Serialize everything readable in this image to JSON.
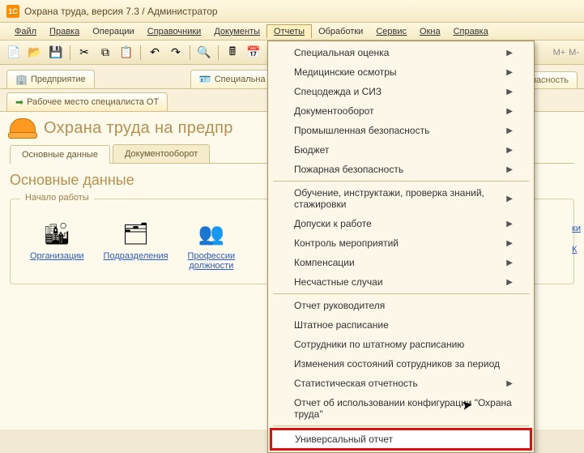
{
  "window": {
    "title": "Охрана труда, версия 7.3 / Администратор"
  },
  "menubar": {
    "file": "Файл",
    "edit": "Правка",
    "operations": "Операции",
    "references": "Справочники",
    "documents": "Документы",
    "reports": "Отчеты",
    "processing": "Обработки",
    "service": "Сервис",
    "windows": "Окна",
    "help": "Справка"
  },
  "toolbar": {
    "m_plus": "M+",
    "m_minus": "M-"
  },
  "tabs": {
    "t1": "Предприятие",
    "t2": "Специальна",
    "t3": "Рабочее место специалиста ОТ",
    "safety": "пасность"
  },
  "page": {
    "title": "Охрана труда на предпр",
    "inner_tabs": {
      "main": "Основные данные",
      "doc": "Документооборот"
    },
    "section": "Основные данные",
    "group": "Начало работы",
    "items": {
      "org": "Организации",
      "dep": "Подразделения",
      "prof": "Профессии\nдолжности"
    }
  },
  "right_links": {
    "a": "ки",
    "b": "К"
  },
  "dropdown": {
    "i1": "Специальная оценка",
    "i2": "Медицинские осмотры",
    "i3": "Спецодежда и СИЗ",
    "i4": "Документооборот",
    "i5": "Промышленная безопасность",
    "i6": "Бюджет",
    "i7": "Пожарная безопасность",
    "i8": "Обучение, инструктажи, проверка знаний, стажировки",
    "i9": "Допуски к работе",
    "i10": "Контроль мероприятий",
    "i11": "Компенсации",
    "i12": "Несчастные случаи",
    "i13": "Отчет руководителя",
    "i14": "Штатное расписание",
    "i15": "Сотрудники по штатному расписанию",
    "i16": "Изменения состояний сотрудников за период",
    "i17": "Статистическая отчетность",
    "i18": "Отчет об использовании конфигурации \"Охрана труда\"",
    "i19": "Универсальный отчет"
  }
}
